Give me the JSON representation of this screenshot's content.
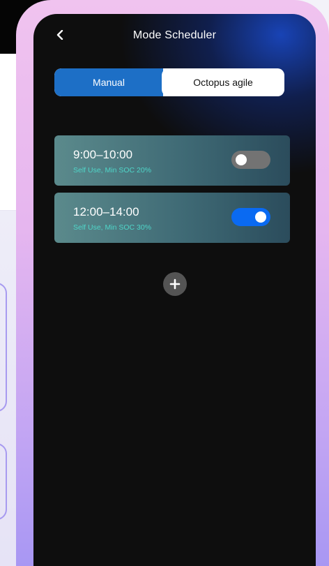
{
  "header": {
    "title": "Mode Scheduler",
    "back_icon": "chevron-left-icon"
  },
  "mode_tabs": [
    {
      "label": "Manual",
      "selected": true
    },
    {
      "label": "Octopus agile",
      "selected": false
    }
  ],
  "schedules": [
    {
      "time": "9:00–10:00",
      "detail": "Self Use, Min SOC 20%",
      "enabled": false
    },
    {
      "time": "12:00–14:00",
      "detail": "Self Use, Min SOC 30%",
      "enabled": true
    }
  ],
  "add_button": {
    "icon": "plus-icon"
  },
  "colors": {
    "accent_blue": "#1d6fc6",
    "toggle_on": "#0a6af2",
    "toggle_off": "#737373",
    "detail_teal": "#4fd6c9",
    "screen_bg": "#0e0e0e"
  }
}
